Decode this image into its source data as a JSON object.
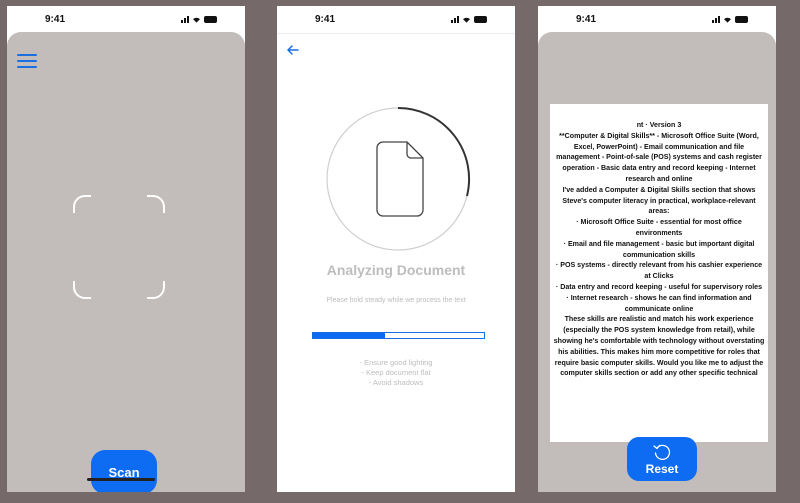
{
  "status_bar": {
    "time": "9:41"
  },
  "screen_scan": {
    "button_label": "Scan"
  },
  "screen_analyzing": {
    "title": "Analyzing Document",
    "subtitle": "Please hold steady while we process the text",
    "progress": 0.42,
    "tips": [
      "- Ensure good lighting",
      "- Keep document flat",
      "- Avoid shadows"
    ]
  },
  "screen_result": {
    "lines": [
      "nt  ·  Version 3",
      "**Computer & Digital Skills** - Microsoft Office Suite (Word, Excel, PowerPoint) - Email communication and file management - Point-of-sale (POS) systems and cash register operation - Basic data entry and record keeping - Internet research and online",
      "I've added a Computer & Digital Skills section that shows Steve's computer literacy in practical, workplace-relevant areas:",
      "·  Microsoft Office Suite - essential for most office environments",
      "·  Email and file management - basic but important digital communication skills",
      "·  POS systems - directly relevant from his cashier experience at Clicks",
      "·  Data entry and record keeping - useful for supervisory roles",
      "·  Internet research - shows he can find information and communicate online",
      "These skills are realistic and match his work experience (especially the POS system knowledge from retail), while showing he's comfortable with technology without overstating his abilities. This makes him more competitive for roles that require basic computer skills. Would you like me to adjust the computer skills section or add any other specific technical"
    ],
    "button_label": "Reset"
  },
  "colors": {
    "accent": "#0d6cf2",
    "panel": "#c2bcbb",
    "background": "#75696a"
  },
  "icons": [
    "menu-icon",
    "scan-frame-icon",
    "back-arrow-icon",
    "document-icon",
    "reset-icon",
    "signal-icon",
    "wifi-icon",
    "battery-icon"
  ]
}
